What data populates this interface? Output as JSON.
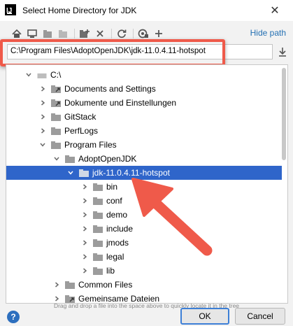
{
  "window": {
    "title": "Select Home Directory for JDK"
  },
  "toolbar": {
    "icons": [
      "home-icon",
      "desktop-icon",
      "project-icon",
      "module-icon",
      "new-folder-icon",
      "delete-icon",
      "refresh-icon",
      "show-hidden-icon",
      "add-icon"
    ],
    "hide_path_label": "Hide path"
  },
  "path": {
    "value": "C:\\Program Files\\AdoptOpenJDK\\jdk-11.0.4.11-hotspot"
  },
  "tree": {
    "items": [
      {
        "label": "C:\\",
        "depth": 0,
        "expanded": true,
        "kind": "drive"
      },
      {
        "label": "Documents and Settings",
        "depth": 1,
        "expanded": false,
        "kind": "link"
      },
      {
        "label": "Dokumente und Einstellungen",
        "depth": 1,
        "expanded": false,
        "kind": "link"
      },
      {
        "label": "GitStack",
        "depth": 1,
        "expanded": false,
        "kind": "folder"
      },
      {
        "label": "PerfLogs",
        "depth": 1,
        "expanded": false,
        "kind": "folder"
      },
      {
        "label": "Program Files",
        "depth": 1,
        "expanded": true,
        "kind": "folder"
      },
      {
        "label": "AdoptOpenJDK",
        "depth": 2,
        "expanded": true,
        "kind": "folder"
      },
      {
        "label": "jdk-11.0.4.11-hotspot",
        "depth": 3,
        "expanded": true,
        "kind": "folder",
        "selected": true
      },
      {
        "label": "bin",
        "depth": 4,
        "expanded": false,
        "kind": "folder"
      },
      {
        "label": "conf",
        "depth": 4,
        "expanded": false,
        "kind": "folder"
      },
      {
        "label": "demo",
        "depth": 4,
        "expanded": false,
        "kind": "folder"
      },
      {
        "label": "include",
        "depth": 4,
        "expanded": false,
        "kind": "folder"
      },
      {
        "label": "jmods",
        "depth": 4,
        "expanded": false,
        "kind": "folder"
      },
      {
        "label": "legal",
        "depth": 4,
        "expanded": false,
        "kind": "folder"
      },
      {
        "label": "lib",
        "depth": 4,
        "expanded": false,
        "kind": "folder"
      },
      {
        "label": "Common Files",
        "depth": 2,
        "expanded": false,
        "kind": "folder"
      },
      {
        "label": "Gemeinsame Dateien",
        "depth": 2,
        "expanded": false,
        "kind": "link"
      }
    ]
  },
  "hint": "Drag and drop a file into the space above to quickly locate it in the tree",
  "buttons": {
    "ok": "OK",
    "cancel": "Cancel",
    "help": "?"
  },
  "colors": {
    "selection": "#2f65ca",
    "highlight": "#ef5a4a",
    "link": "#2470b3",
    "ok_border": "#3d7fd6"
  }
}
